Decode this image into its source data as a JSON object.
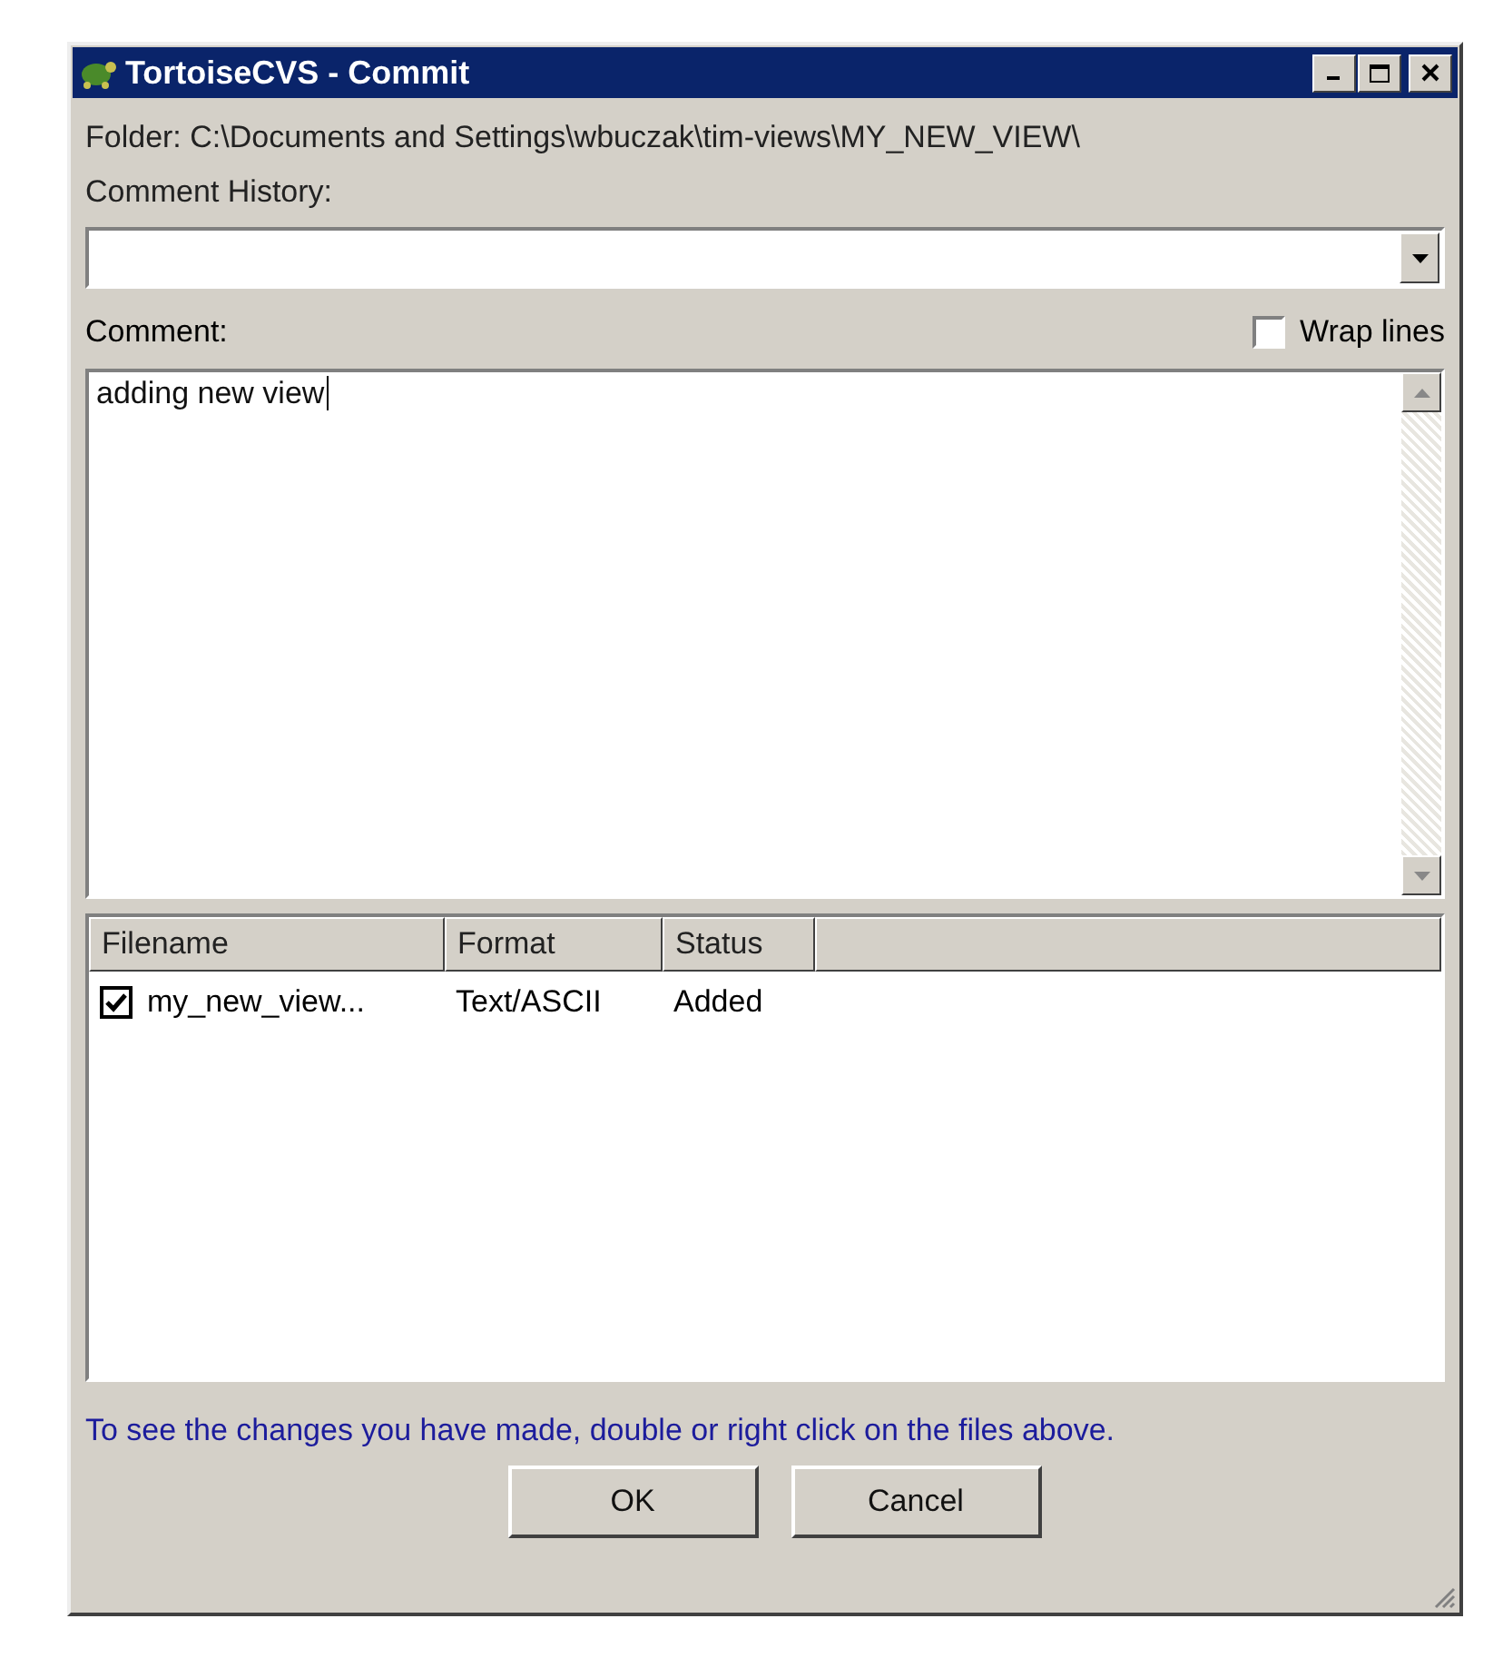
{
  "window": {
    "title": "TortoiseCVS - Commit"
  },
  "folder": "Folder: C:\\Documents and Settings\\wbuczak\\tim-views\\MY_NEW_VIEW\\",
  "comment_history": {
    "label": "Comment History:"
  },
  "comment": {
    "label": "Comment:",
    "value": "adding new view"
  },
  "wrap_lines": {
    "label": "Wrap lines",
    "checked": false
  },
  "files": {
    "columns": [
      "Filename",
      "Format",
      "Status"
    ],
    "rows": [
      {
        "checked": true,
        "cells": [
          "my_new_view...",
          "Text/ASCII",
          "Added"
        ]
      }
    ]
  },
  "hint": "To see the changes you have made, double or right click on the files above.",
  "buttons": [
    "OK",
    "Cancel"
  ]
}
